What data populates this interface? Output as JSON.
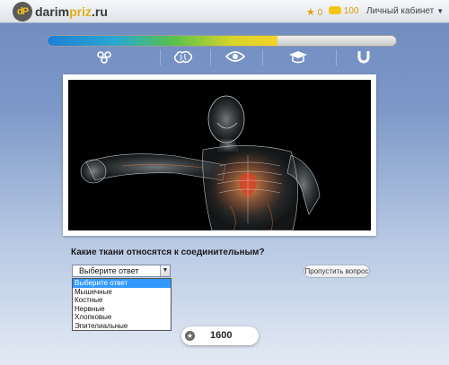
{
  "header": {
    "logo_mark": "dP",
    "logo_text_main": "darim",
    "logo_text_accent": "priz",
    "logo_text_tld": ".ru",
    "stars_count": "0",
    "coins_count": "100",
    "cabinet_label": "Личный кабинет"
  },
  "progress": {
    "fill_fraction": 0.66,
    "stages": [
      "molecules-icon",
      "brain-icon",
      "eye-icon",
      "graduation-cap-icon",
      "magnet-icon"
    ]
  },
  "question": {
    "text": "Какие ткани относятся к соединительным?",
    "image_alt": "human-anatomy-illustration"
  },
  "answer_select": {
    "selected": "Выберите ответ",
    "options": [
      "Выберите ответ",
      "Мышечные",
      "Костные",
      "Нервные",
      "Хлопковые",
      "Эпителиальные"
    ]
  },
  "skip_label": "Пропустить вопрос",
  "score_value": "1600",
  "colors": {
    "accent": "#e3ad15",
    "select_highlight": "#3399ff"
  }
}
